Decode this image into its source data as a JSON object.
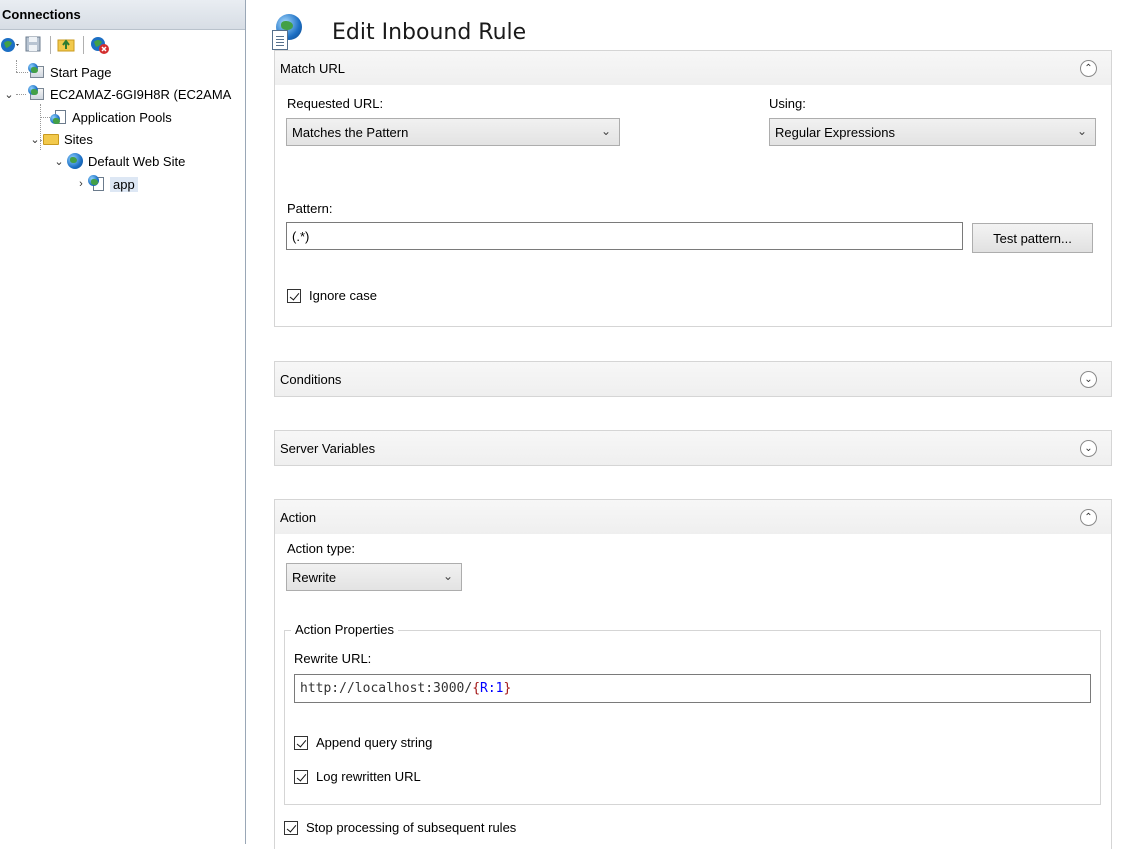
{
  "connections": {
    "title": "Connections",
    "toolbar": [
      "connect-icon",
      "save-icon",
      "folder-up-icon",
      "disconnect-icon"
    ],
    "tree": [
      {
        "label": "Start Page",
        "icon": "start-page-icon"
      },
      {
        "label": "EC2AMAZ-6GI9H8R (EC2AMA",
        "icon": "server-icon"
      },
      {
        "label": "Application Pools",
        "icon": "app-pools-icon"
      },
      {
        "label": "Sites",
        "icon": "sites-folder-icon"
      },
      {
        "label": "Default Web Site",
        "icon": "globe-icon"
      },
      {
        "label": "app",
        "icon": "app-icon"
      }
    ]
  },
  "page": {
    "title": "Edit Inbound Rule"
  },
  "match_url": {
    "title": "Match URL",
    "requested_url_label": "Requested URL:",
    "requested_url_value": "Matches the Pattern",
    "using_label": "Using:",
    "using_value": "Regular Expressions",
    "pattern_label": "Pattern:",
    "pattern_value": "(.*)",
    "test_pattern_button": "Test pattern...",
    "ignore_case_label": "Ignore case",
    "ignore_case_checked": true
  },
  "conditions": {
    "title": "Conditions"
  },
  "server_variables": {
    "title": "Server Variables"
  },
  "action": {
    "title": "Action",
    "action_type_label": "Action type:",
    "action_type_value": "Rewrite",
    "properties_legend": "Action Properties",
    "rewrite_url_label": "Rewrite URL:",
    "rewrite_url_prefix": "http://localhost:3000/",
    "rewrite_url_brace_open": "{",
    "rewrite_url_var": "R:1",
    "rewrite_url_brace_close": "}",
    "append_query_label": "Append query string",
    "log_rewritten_label": "Log rewritten URL",
    "stop_processing_label": "Stop processing of subsequent rules"
  }
}
